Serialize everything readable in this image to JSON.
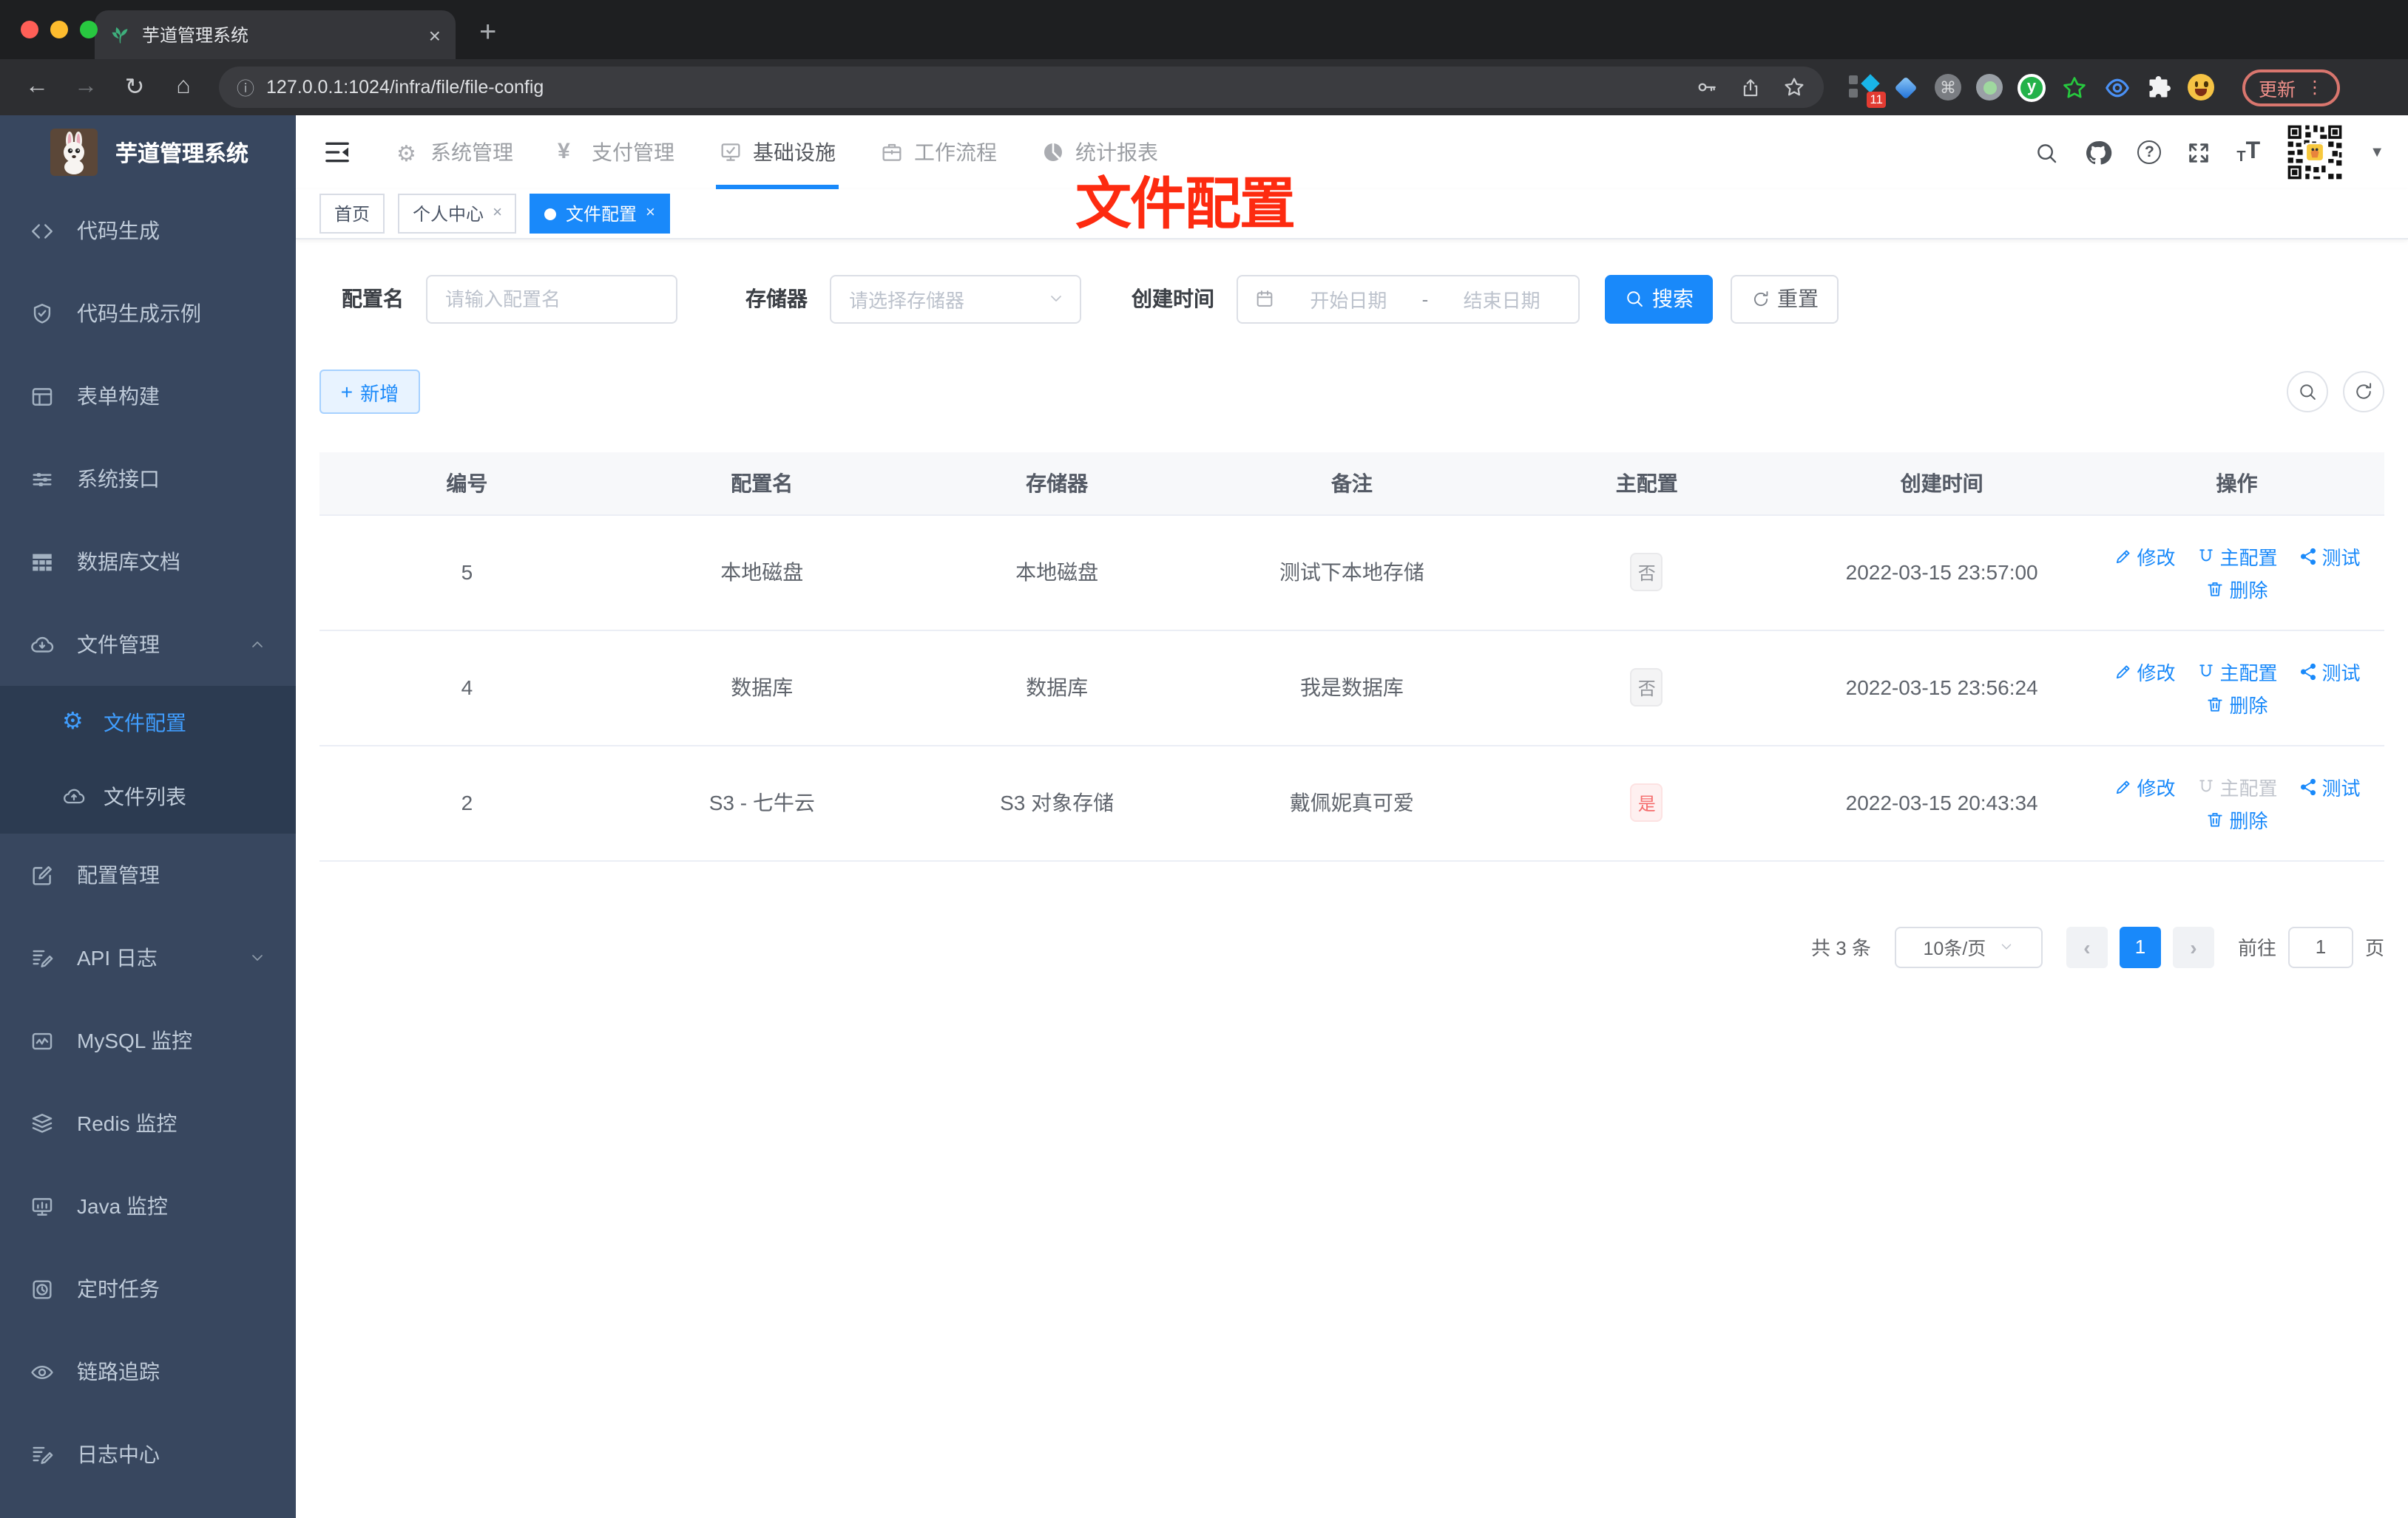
{
  "colors": {
    "accent": "#1989fa",
    "accent-weak": "#e8f3ff",
    "accent-border": "#a6d1ff",
    "danger": "#f56c6c",
    "danger-bg": "#fef0f0",
    "danger-border": "#fde2e2",
    "info-text": "#909399",
    "info-bg": "#f4f4f5",
    "info-border": "#e9e9eb",
    "sidebar-bg": "#38475f",
    "sidebar-sub-bg": "#2c3b51",
    "sidebar-text": "#bfcbd9",
    "annotation-red": "#fd2b10"
  },
  "browser": {
    "tab_title": "芋道管理系统",
    "url": "127.0.0.1:1024/infra/file/file-config",
    "update_label": "更新",
    "ext_badge": "11",
    "ext_y_letter": "y"
  },
  "sidebar": {
    "title": "芋道管理系统",
    "items": [
      {
        "label": "代码生成"
      },
      {
        "label": "代码生成示例"
      },
      {
        "label": "表单构建"
      },
      {
        "label": "系统接口"
      },
      {
        "label": "数据库文档"
      },
      {
        "label": "文件管理"
      }
    ],
    "sub": [
      {
        "label": "文件配置"
      },
      {
        "label": "文件列表"
      }
    ],
    "items2": [
      {
        "label": "配置管理"
      },
      {
        "label": "API 日志"
      },
      {
        "label": "MySQL 监控"
      },
      {
        "label": "Redis 监控"
      },
      {
        "label": "Java 监控"
      },
      {
        "label": "定时任务"
      },
      {
        "label": "链路追踪"
      },
      {
        "label": "日志中心"
      }
    ]
  },
  "topnav": {
    "items": [
      {
        "label": "系统管理"
      },
      {
        "label": "支付管理"
      },
      {
        "label": "基础设施"
      },
      {
        "label": "工作流程"
      },
      {
        "label": "统计报表"
      }
    ]
  },
  "tags": [
    {
      "label": "首页"
    },
    {
      "label": "个人中心"
    },
    {
      "label": "文件配置"
    }
  ],
  "annotation": {
    "text": "文件配置"
  },
  "filters": {
    "name_label": "配置名",
    "name_placeholder": "请输入配置名",
    "storage_label": "存储器",
    "storage_placeholder": "请选择存储器",
    "time_label": "创建时间",
    "start_placeholder": "开始日期",
    "range_sep": "-",
    "end_placeholder": "结束日期",
    "search_label": "搜索",
    "reset_label": "重置"
  },
  "toolbar": {
    "add_label": "新增"
  },
  "table": {
    "headers": [
      "编号",
      "配置名",
      "存储器",
      "备注",
      "主配置",
      "创建时间",
      "操作"
    ],
    "actions": {
      "edit": "修改",
      "master": "主配置",
      "test": "测试",
      "delete": "删除"
    },
    "rows": [
      {
        "id": "5",
        "name": "本地磁盘",
        "storage": "本地磁盘",
        "remark": "测试下本地存储",
        "master": "否",
        "created": "2022-03-15 23:57:00"
      },
      {
        "id": "4",
        "name": "数据库",
        "storage": "数据库",
        "remark": "我是数据库",
        "master": "否",
        "created": "2022-03-15 23:56:24"
      },
      {
        "id": "2",
        "name": "S3 - 七牛云",
        "storage": "S3 对象存储",
        "remark": "戴佩妮真可爱",
        "master": "是",
        "created": "2022-03-15 20:43:34"
      }
    ]
  },
  "pagination": {
    "total": "共 3 条",
    "size": "10条/页",
    "prev": "‹",
    "next": "›",
    "page": "1",
    "goto": "前往",
    "value": "1",
    "unit": "页"
  }
}
